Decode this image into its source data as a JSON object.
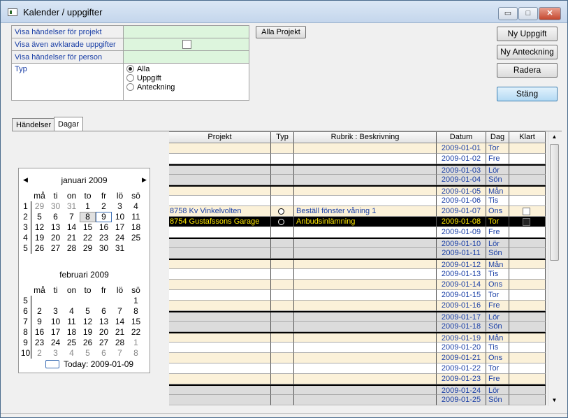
{
  "window": {
    "title": "Kalender / uppgifter",
    "min_glyph": "▭",
    "max_glyph": "□",
    "close_glyph": "✕"
  },
  "filter": {
    "project_label": "Visa händelser för projekt",
    "project_value": "",
    "completed_label": "Visa även avklarade uppgifter",
    "completed_checked": false,
    "person_label": "Visa händelser för person",
    "person_value": "",
    "type_label": "Typ",
    "type_options": [
      "Alla",
      "Uppgift",
      "Anteckning"
    ],
    "type_selected": "Alla"
  },
  "buttons": {
    "all_projects": "Alla Projekt",
    "new_task": "Ny Uppgift",
    "new_note": "Ny Anteckning",
    "delete": "Radera",
    "close": "Stäng"
  },
  "tabs": [
    {
      "label": "Händelser"
    },
    {
      "label": "Dagar"
    }
  ],
  "tab_active": "Dagar",
  "calendar": {
    "prev_glyph": "◀",
    "next_glyph": "▶",
    "weekday_headers": [
      "må",
      "ti",
      "on",
      "to",
      "fr",
      "lö",
      "sö"
    ],
    "months": [
      {
        "title": "januari 2009",
        "weeks": [
          {
            "wk": "1",
            "days": [
              "29",
              "30",
              "31",
              "1",
              "2",
              "3",
              "4"
            ]
          },
          {
            "wk": "2",
            "days": [
              "5",
              "6",
              "7",
              "8",
              "9",
              "10",
              "11"
            ]
          },
          {
            "wk": "3",
            "days": [
              "12",
              "13",
              "14",
              "15",
              "16",
              "17",
              "18"
            ]
          },
          {
            "wk": "4",
            "days": [
              "19",
              "20",
              "21",
              "22",
              "23",
              "24",
              "25"
            ]
          },
          {
            "wk": "5",
            "days": [
              "26",
              "27",
              "28",
              "29",
              "30",
              "31",
              ""
            ]
          }
        ]
      },
      {
        "title": "februari 2009",
        "weeks": [
          {
            "wk": "5",
            "days": [
              "",
              "",
              "",
              "",
              "",
              "",
              "1"
            ]
          },
          {
            "wk": "6",
            "days": [
              "2",
              "3",
              "4",
              "5",
              "6",
              "7",
              "8"
            ]
          },
          {
            "wk": "7",
            "days": [
              "9",
              "10",
              "11",
              "12",
              "13",
              "14",
              "15"
            ]
          },
          {
            "wk": "8",
            "days": [
              "16",
              "17",
              "18",
              "19",
              "20",
              "21",
              "22"
            ]
          },
          {
            "wk": "9",
            "days": [
              "23",
              "24",
              "25",
              "26",
              "27",
              "28",
              "1"
            ]
          },
          {
            "wk": "10",
            "days": [
              "2",
              "3",
              "4",
              "5",
              "6",
              "7",
              "8"
            ]
          }
        ]
      }
    ],
    "selected_day": "8",
    "today_day": "9",
    "today_label": "Today: 2009-01-09"
  },
  "grid": {
    "columns": [
      "Projekt",
      "Typ",
      "Rubrik : Beskrivning",
      "Datum",
      "Dag",
      "Klart"
    ],
    "rows": [
      {
        "projekt": "",
        "typ": false,
        "rubrik": "",
        "datum": "2009-01-01",
        "dag": "Tor",
        "klart": null,
        "style": "beige",
        "sep": false
      },
      {
        "projekt": "",
        "typ": false,
        "rubrik": "",
        "datum": "2009-01-02",
        "dag": "Fre",
        "klart": null,
        "style": "white",
        "sep": false
      },
      {
        "projekt": "",
        "typ": false,
        "rubrik": "",
        "datum": "2009-01-03",
        "dag": "Lör",
        "klart": null,
        "style": "gray",
        "sep": true
      },
      {
        "projekt": "",
        "typ": false,
        "rubrik": "",
        "datum": "2009-01-04",
        "dag": "Sön",
        "klart": null,
        "style": "gray",
        "sep": false
      },
      {
        "projekt": "",
        "typ": false,
        "rubrik": "",
        "datum": "2009-01-05",
        "dag": "Mån",
        "klart": null,
        "style": "beige",
        "sep": true
      },
      {
        "projekt": "",
        "typ": false,
        "rubrik": "",
        "datum": "2009-01-06",
        "dag": "Tis",
        "klart": null,
        "style": "white",
        "sep": false
      },
      {
        "projekt": "8758 Kv Vinkelvolten",
        "typ": true,
        "rubrik": "Beställ fönster våning 1",
        "datum": "2009-01-07",
        "dag": "Ons",
        "klart": false,
        "style": "beige",
        "sep": false
      },
      {
        "projekt": "8754 Gustafssons Garage",
        "typ": true,
        "rubrik": "Anbudsinlämning",
        "datum": "2009-01-08",
        "dag": "Tor",
        "klart": false,
        "style": "sel",
        "sep": false
      },
      {
        "projekt": "",
        "typ": false,
        "rubrik": "",
        "datum": "2009-01-09",
        "dag": "Fre",
        "klart": null,
        "style": "white",
        "sep": false
      },
      {
        "projekt": "",
        "typ": false,
        "rubrik": "",
        "datum": "2009-01-10",
        "dag": "Lör",
        "klart": null,
        "style": "gray",
        "sep": true
      },
      {
        "projekt": "",
        "typ": false,
        "rubrik": "",
        "datum": "2009-01-11",
        "dag": "Sön",
        "klart": null,
        "style": "gray",
        "sep": false
      },
      {
        "projekt": "",
        "typ": false,
        "rubrik": "",
        "datum": "2009-01-12",
        "dag": "Mån",
        "klart": null,
        "style": "beige",
        "sep": true
      },
      {
        "projekt": "",
        "typ": false,
        "rubrik": "",
        "datum": "2009-01-13",
        "dag": "Tis",
        "klart": null,
        "style": "white",
        "sep": false
      },
      {
        "projekt": "",
        "typ": false,
        "rubrik": "",
        "datum": "2009-01-14",
        "dag": "Ons",
        "klart": null,
        "style": "beige",
        "sep": false
      },
      {
        "projekt": "",
        "typ": false,
        "rubrik": "",
        "datum": "2009-01-15",
        "dag": "Tor",
        "klart": null,
        "style": "white",
        "sep": false
      },
      {
        "projekt": "",
        "typ": false,
        "rubrik": "",
        "datum": "2009-01-16",
        "dag": "Fre",
        "klart": null,
        "style": "beige",
        "sep": false
      },
      {
        "projekt": "",
        "typ": false,
        "rubrik": "",
        "datum": "2009-01-17",
        "dag": "Lör",
        "klart": null,
        "style": "gray",
        "sep": true
      },
      {
        "projekt": "",
        "typ": false,
        "rubrik": "",
        "datum": "2009-01-18",
        "dag": "Sön",
        "klart": null,
        "style": "gray",
        "sep": false
      },
      {
        "projekt": "",
        "typ": false,
        "rubrik": "",
        "datum": "2009-01-19",
        "dag": "Mån",
        "klart": null,
        "style": "beige",
        "sep": true
      },
      {
        "projekt": "",
        "typ": false,
        "rubrik": "",
        "datum": "2009-01-20",
        "dag": "Tis",
        "klart": null,
        "style": "white",
        "sep": false
      },
      {
        "projekt": "",
        "typ": false,
        "rubrik": "",
        "datum": "2009-01-21",
        "dag": "Ons",
        "klart": null,
        "style": "beige",
        "sep": false
      },
      {
        "projekt": "",
        "typ": false,
        "rubrik": "",
        "datum": "2009-01-22",
        "dag": "Tor",
        "klart": null,
        "style": "white",
        "sep": false
      },
      {
        "projekt": "",
        "typ": false,
        "rubrik": "",
        "datum": "2009-01-23",
        "dag": "Fre",
        "klart": null,
        "style": "beige",
        "sep": false
      },
      {
        "projekt": "",
        "typ": false,
        "rubrik": "",
        "datum": "2009-01-24",
        "dag": "Lör",
        "klart": null,
        "style": "gray",
        "sep": true
      },
      {
        "projekt": "",
        "typ": false,
        "rubrik": "",
        "datum": "2009-01-25",
        "dag": "Sön",
        "klart": null,
        "style": "gray",
        "sep": false
      }
    ]
  },
  "scrollbar": {
    "up_glyph": "▲",
    "down_glyph": "▼"
  }
}
